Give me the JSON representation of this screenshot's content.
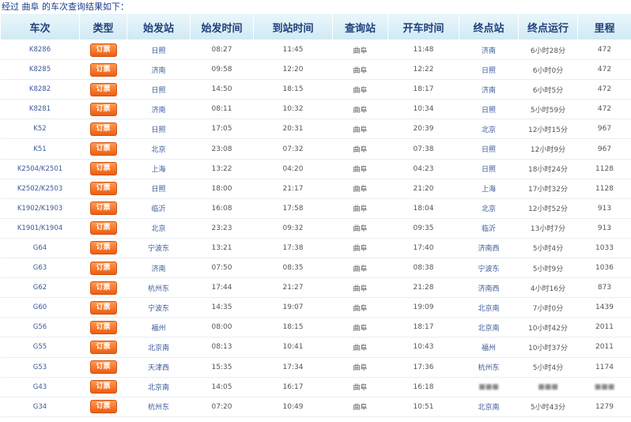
{
  "caption": {
    "prefix": "经过",
    "station": "曲阜",
    "suffix": "的车次查询结果如下："
  },
  "book_label": "订票",
  "columns": [
    "车次",
    "类型",
    "始发站",
    "始发时间",
    "到站时间",
    "查询站",
    "开车时间",
    "终点站",
    "终点运行",
    "里程"
  ],
  "rows": [
    {
      "train": "K8286",
      "origin": "日照",
      "depart": "08:27",
      "arrive": "11:45",
      "query": "曲阜",
      "leave": "11:48",
      "terminal": "济南",
      "duration": "6小时28分",
      "distance": "472"
    },
    {
      "train": "K8285",
      "origin": "济南",
      "depart": "09:58",
      "arrive": "12:20",
      "query": "曲阜",
      "leave": "12:22",
      "terminal": "日照",
      "duration": "6小时0分",
      "distance": "472"
    },
    {
      "train": "K8282",
      "origin": "日照",
      "depart": "14:50",
      "arrive": "18:15",
      "query": "曲阜",
      "leave": "18:17",
      "terminal": "济南",
      "duration": "6小时5分",
      "distance": "472"
    },
    {
      "train": "K8281",
      "origin": "济南",
      "depart": "08:11",
      "arrive": "10:32",
      "query": "曲阜",
      "leave": "10:34",
      "terminal": "日照",
      "duration": "5小时59分",
      "distance": "472"
    },
    {
      "train": "K52",
      "origin": "日照",
      "depart": "17:05",
      "arrive": "20:31",
      "query": "曲阜",
      "leave": "20:39",
      "terminal": "北京",
      "duration": "12小时15分",
      "distance": "967"
    },
    {
      "train": "K51",
      "origin": "北京",
      "depart": "23:08",
      "arrive": "07:32",
      "query": "曲阜",
      "leave": "07:38",
      "terminal": "日照",
      "duration": "12小时9分",
      "distance": "967"
    },
    {
      "train": "K2504/K2501",
      "origin": "上海",
      "depart": "13:22",
      "arrive": "04:20",
      "query": "曲阜",
      "leave": "04:23",
      "terminal": "日照",
      "duration": "18小时24分",
      "distance": "1128"
    },
    {
      "train": "K2502/K2503",
      "origin": "日照",
      "depart": "18:00",
      "arrive": "21:17",
      "query": "曲阜",
      "leave": "21:20",
      "terminal": "上海",
      "duration": "17小时32分",
      "distance": "1128"
    },
    {
      "train": "K1902/K1903",
      "origin": "临沂",
      "depart": "16:08",
      "arrive": "17:58",
      "query": "曲阜",
      "leave": "18:04",
      "terminal": "北京",
      "duration": "12小时52分",
      "distance": "913"
    },
    {
      "train": "K1901/K1904",
      "origin": "北京",
      "depart": "23:23",
      "arrive": "09:32",
      "query": "曲阜",
      "leave": "09:35",
      "terminal": "临沂",
      "duration": "13小时7分",
      "distance": "913"
    },
    {
      "train": "G64",
      "origin": "宁波东",
      "depart": "13:21",
      "arrive": "17:38",
      "query": "曲阜",
      "leave": "17:40",
      "terminal": "济南西",
      "duration": "5小时4分",
      "distance": "1033"
    },
    {
      "train": "G63",
      "origin": "济南",
      "depart": "07:50",
      "arrive": "08:35",
      "query": "曲阜",
      "leave": "08:38",
      "terminal": "宁波东",
      "duration": "5小时9分",
      "distance": "1036"
    },
    {
      "train": "G62",
      "origin": "杭州东",
      "depart": "17:44",
      "arrive": "21:27",
      "query": "曲阜",
      "leave": "21:28",
      "terminal": "济南西",
      "duration": "4小时16分",
      "distance": "873"
    },
    {
      "train": "G60",
      "origin": "宁波东",
      "depart": "14:35",
      "arrive": "19:07",
      "query": "曲阜",
      "leave": "19:09",
      "terminal": "北京南",
      "duration": "7小时0分",
      "distance": "1439"
    },
    {
      "train": "G56",
      "origin": "福州",
      "depart": "08:00",
      "arrive": "18:15",
      "query": "曲阜",
      "leave": "18:17",
      "terminal": "北京南",
      "duration": "10小时42分",
      "distance": "2011"
    },
    {
      "train": "G55",
      "origin": "北京南",
      "depart": "08:13",
      "arrive": "10:41",
      "query": "曲阜",
      "leave": "10:43",
      "terminal": "福州",
      "duration": "10小时37分",
      "distance": "2011"
    },
    {
      "train": "G53",
      "origin": "天津西",
      "depart": "15:35",
      "arrive": "17:34",
      "query": "曲阜",
      "leave": "17:36",
      "terminal": "杭州东",
      "duration": "5小时4分",
      "distance": "1174"
    },
    {
      "train": "G43",
      "origin": "北京南",
      "depart": "14:05",
      "arrive": "16:17",
      "query": "曲阜",
      "leave": "16:18",
      "terminal": "",
      "duration": "",
      "distance": "",
      "blurred": true
    },
    {
      "train": "G34",
      "origin": "杭州东",
      "depart": "07:20",
      "arrive": "10:49",
      "query": "曲阜",
      "leave": "10:51",
      "terminal": "北京南",
      "duration": "5小时43分",
      "distance": "1279"
    }
  ]
}
